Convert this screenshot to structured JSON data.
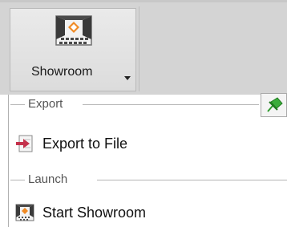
{
  "ribbon": {
    "button": {
      "label": "Showroom",
      "icon": "showroom-icon"
    }
  },
  "menu": {
    "groups": [
      {
        "header": "Export",
        "items": [
          {
            "label": "Export to File",
            "icon": "export-file-icon"
          }
        ]
      },
      {
        "header": "Launch",
        "items": [
          {
            "label": "Start Showroom",
            "icon": "showroom-icon"
          }
        ]
      }
    ],
    "pin": {
      "icon": "pin-icon",
      "color": "#2e9b2e"
    }
  },
  "colors": {
    "ribbon_bg": "#d4d4d4",
    "menu_bg": "#ffffff",
    "export_arrow": "#c4314b",
    "logo_orange": "#f08a24"
  }
}
